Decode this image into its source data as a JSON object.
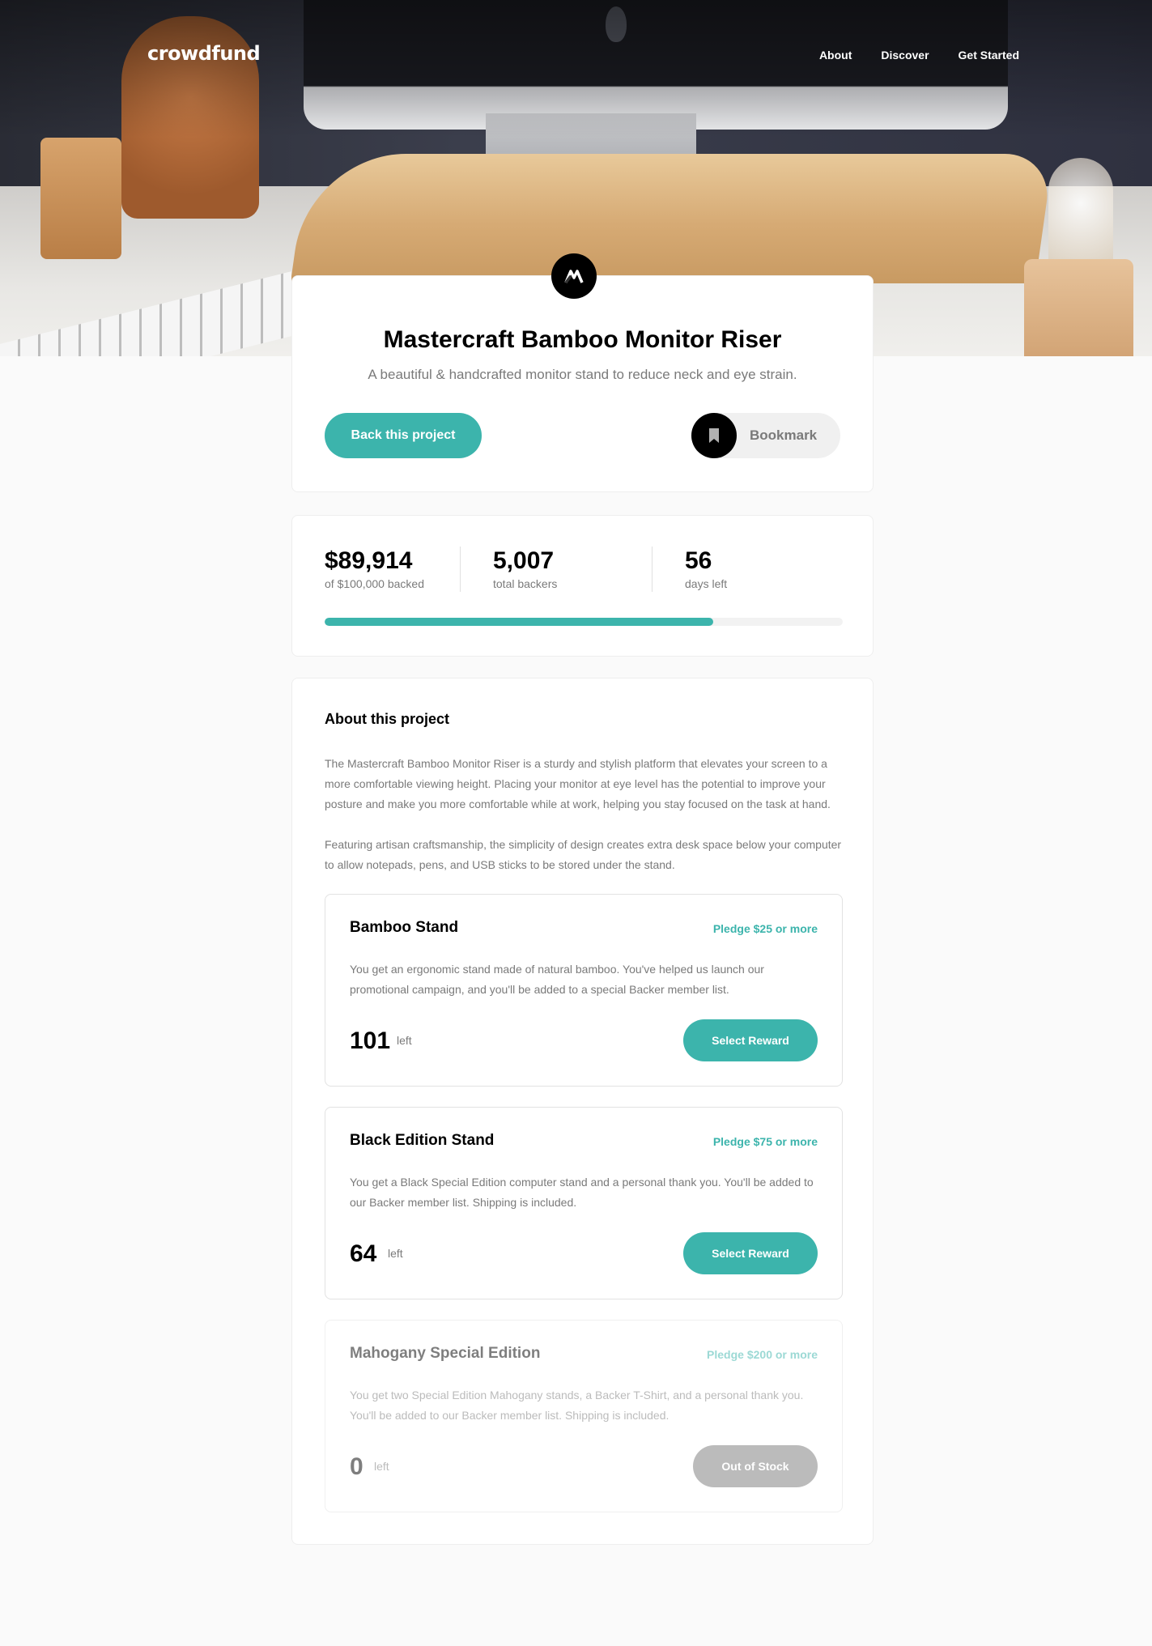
{
  "header": {
    "logo": "crowdfund",
    "nav": [
      "About",
      "Discover",
      "Get Started"
    ]
  },
  "project": {
    "title": "Mastercraft Bamboo Monitor Riser",
    "description": "A beautiful & handcrafted monitor stand to reduce neck and eye strain.",
    "back_label": "Back this project",
    "bookmark_label": "Bookmark",
    "logo_icon": "mastercraft-logo-icon",
    "bookmark_icon": "bookmark-icon"
  },
  "stats": {
    "backed_amount": "$89,914",
    "backed_caption": "of $100,000 backed",
    "backers": "5,007",
    "backers_caption": "total backers",
    "days": "56",
    "days_caption": "days left",
    "progress": 0.75
  },
  "about": {
    "title": "About this project",
    "paragraphs": [
      "The Mastercraft Bamboo Monitor Riser is a sturdy and stylish platform that elevates your screen to a more comfortable viewing height. Placing your monitor at eye level has the potential to improve your posture and make you more comfortable while at work, helping you stay focused on the task at hand.",
      "Featuring artisan craftsmanship, the simplicity of design creates extra desk space below your computer to allow notepads, pens, and USB sticks to be stored under the stand."
    ]
  },
  "rewards": [
    {
      "name": "Bamboo Stand",
      "pledge": "Pledge $25 or more",
      "description": "You get an ergonomic stand made of natural bamboo. You've helped us launch our promotional campaign, and you'll be added to a special Backer member list.",
      "left": "101",
      "left_label": "left",
      "button": "Select Reward"
    },
    {
      "name": "Black Edition Stand",
      "pledge": "Pledge $75 or more",
      "description": "You get a Black Special Edition computer stand and a personal thank you. You'll be added to our Backer member list. Shipping is included.",
      "left": "64",
      "left_label": "left",
      "button": "Select Reward"
    },
    {
      "name": "Mahogany Special Edition",
      "pledge": "Pledge $200 or more",
      "description": "You get two Special Edition Mahogany stands, a Backer T-Shirt, and a personal thank you. You'll be added to our Backer member list. Shipping is included.",
      "left": "0",
      "left_label": "left",
      "button": "Out of Stock"
    }
  ],
  "colors": {
    "accent": "#3cb4ac",
    "dark": "#000000",
    "muted": "#7a7a7a",
    "background": "#fafafa"
  }
}
